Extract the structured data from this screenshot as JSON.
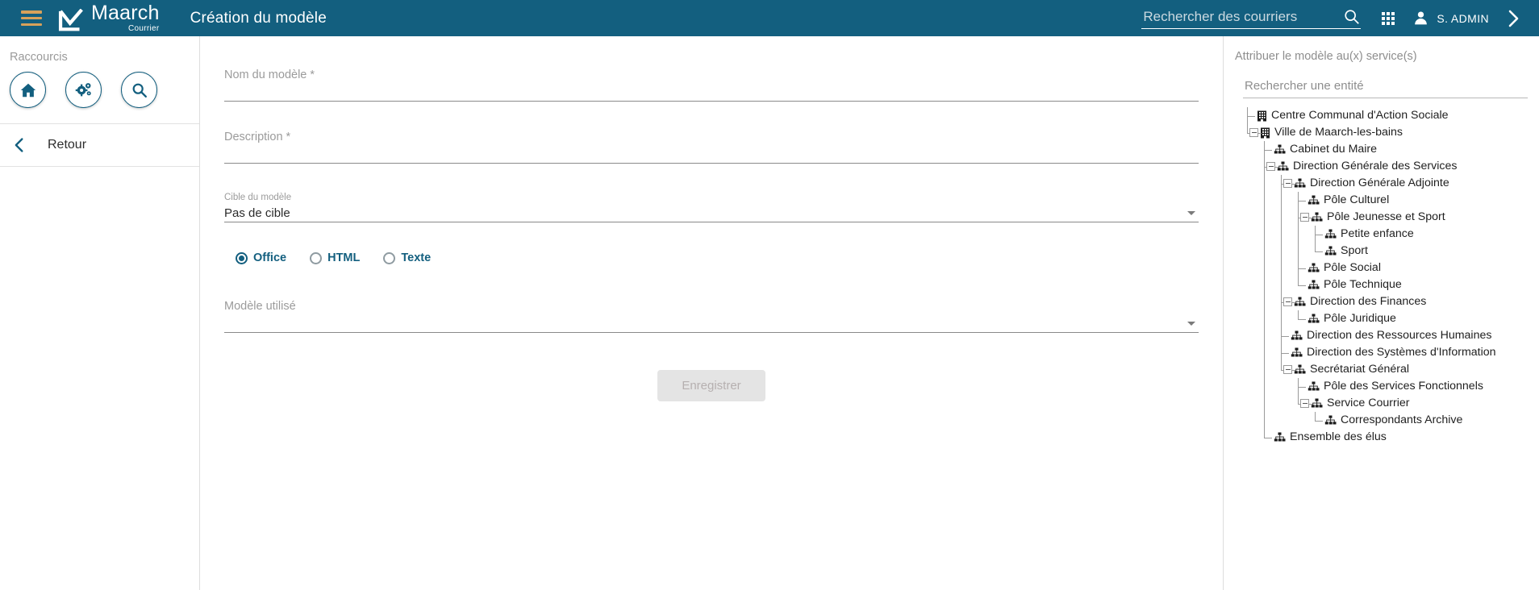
{
  "header": {
    "menu_icon": "hamburger-menu-icon",
    "brand_name": "Maarch",
    "brand_sub": "Courrier",
    "page_title": "Création du modèle",
    "search_placeholder": "Rechercher des courriers",
    "search_value": "",
    "search_icon": "search-icon",
    "apps_icon": "grid-apps-icon",
    "user_icon": "user-avatar-icon",
    "user_name": "S. ADMIN",
    "expand_icon": "chevron-right-icon"
  },
  "sidebar": {
    "shortcuts_label": "Raccourcis",
    "shortcuts": [
      {
        "name": "home-shortcut",
        "icon": "home-icon"
      },
      {
        "name": "administration-shortcut",
        "icon": "gears-icon"
      },
      {
        "name": "search-shortcut",
        "icon": "search-icon"
      }
    ],
    "back_label": "Retour",
    "back_icon": "chevron-left-icon"
  },
  "form": {
    "name_label": "Nom du modèle *",
    "name_value": "",
    "description_label": "Description *",
    "description_value": "",
    "target_label": "Cible du modèle",
    "target_value": "Pas de cible",
    "target_options": [
      "Pas de cible"
    ],
    "type_options": [
      {
        "label": "Office",
        "selected": true
      },
      {
        "label": "HTML",
        "selected": false
      },
      {
        "label": "Texte",
        "selected": false
      }
    ],
    "template_used_label": "Modèle utilisé",
    "template_used_value": "",
    "save_label": "Enregistrer",
    "save_disabled": true
  },
  "right_panel": {
    "title": "Attribuer le modèle au(x) service(s)",
    "search_placeholder": "Rechercher une entité",
    "search_value": "",
    "tree": [
      {
        "label": "Centre Communal d'Action Sociale",
        "depth": 0,
        "icon": "building-icon",
        "toggle": "none"
      },
      {
        "label": "Ville de Maarch-les-bains",
        "depth": 0,
        "icon": "building-icon",
        "toggle": "expanded"
      },
      {
        "label": "Cabinet du Maire",
        "depth": 1,
        "icon": "org-chart-icon",
        "toggle": "none"
      },
      {
        "label": "Direction Générale des Services",
        "depth": 1,
        "icon": "org-chart-icon",
        "toggle": "expanded"
      },
      {
        "label": "Direction Générale Adjointe",
        "depth": 2,
        "icon": "org-chart-icon",
        "toggle": "expanded"
      },
      {
        "label": "Pôle Culturel",
        "depth": 3,
        "icon": "org-chart-icon",
        "toggle": "none"
      },
      {
        "label": "Pôle Jeunesse et Sport",
        "depth": 3,
        "icon": "org-chart-icon",
        "toggle": "expanded"
      },
      {
        "label": "Petite enfance",
        "depth": 4,
        "icon": "org-chart-icon",
        "toggle": "none"
      },
      {
        "label": "Sport",
        "depth": 4,
        "icon": "org-chart-icon",
        "toggle": "none"
      },
      {
        "label": "Pôle Social",
        "depth": 3,
        "icon": "org-chart-icon",
        "toggle": "none"
      },
      {
        "label": "Pôle Technique",
        "depth": 3,
        "icon": "org-chart-icon",
        "toggle": "none"
      },
      {
        "label": "Direction des Finances",
        "depth": 2,
        "icon": "org-chart-icon",
        "toggle": "expanded"
      },
      {
        "label": "Pôle Juridique",
        "depth": 3,
        "icon": "org-chart-icon",
        "toggle": "none"
      },
      {
        "label": "Direction des Ressources Humaines",
        "depth": 2,
        "icon": "org-chart-icon",
        "toggle": "none"
      },
      {
        "label": "Direction des Systèmes d'Information",
        "depth": 2,
        "icon": "org-chart-icon",
        "toggle": "none"
      },
      {
        "label": "Secrétariat Général",
        "depth": 2,
        "icon": "org-chart-icon",
        "toggle": "expanded"
      },
      {
        "label": "Pôle des Services Fonctionnels",
        "depth": 3,
        "icon": "org-chart-icon",
        "toggle": "none"
      },
      {
        "label": "Service Courrier",
        "depth": 3,
        "icon": "org-chart-icon",
        "toggle": "expanded"
      },
      {
        "label": "Correspondants Archive",
        "depth": 4,
        "icon": "org-chart-icon",
        "toggle": "none"
      },
      {
        "label": "Ensemble des élus",
        "depth": 1,
        "icon": "org-chart-icon",
        "toggle": "none"
      }
    ]
  },
  "colors": {
    "brand_primary": "#135f7f",
    "accent_orange": "#d8a15a",
    "label_grey": "#9b9b9b",
    "text_dark": "#1f1f1f"
  }
}
